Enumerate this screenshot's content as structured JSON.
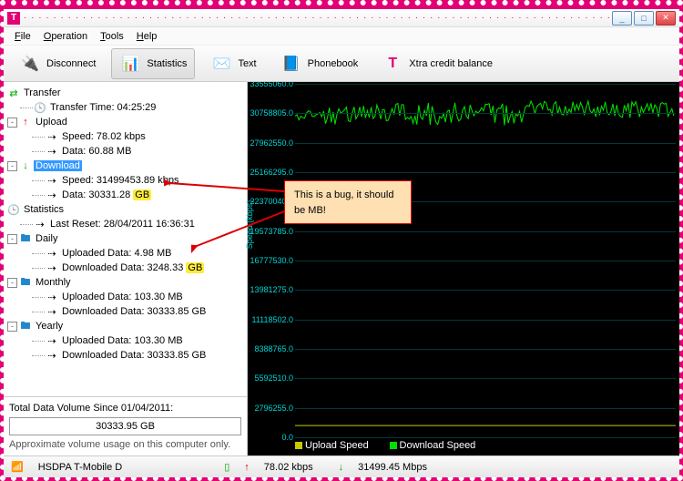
{
  "menu": {
    "file": "File",
    "operation": "Operation",
    "tools": "Tools",
    "help": "Help"
  },
  "toolbar": {
    "disconnect": "Disconnect",
    "statistics": "Statistics",
    "text": "Text",
    "phonebook": "Phonebook",
    "xtra": "Xtra credit balance"
  },
  "tree": {
    "transfer": "Transfer",
    "transfer_time": "Transfer Time: 04:25:29",
    "upload": "Upload",
    "upload_speed": "Speed: 78.02 kbps",
    "upload_data": "Data: 60.88 MB",
    "download": "Download",
    "download_speed": "Speed: 31499453.89 kbps",
    "download_data_pre": "Data: 30331.28 ",
    "download_data_unit": "GB",
    "statistics": "Statistics",
    "last_reset": "Last Reset: 28/04/2011 16:36:31",
    "daily": "Daily",
    "daily_up": "Uploaded Data: 4.98 MB",
    "daily_down_pre": "Downloaded Data: 3248.33 ",
    "daily_down_unit": "GB",
    "monthly": "Monthly",
    "monthly_up": "Uploaded Data: 103.30 MB",
    "monthly_down": "Downloaded Data: 30333.85 GB",
    "yearly": "Yearly",
    "yearly_up": "Uploaded Data: 103.30 MB",
    "yearly_down": "Downloaded Data: 30333.85 GB"
  },
  "total": {
    "label": "Total Data Volume Since 01/04/2011:",
    "value": "30333.95 GB",
    "note": "Approximate volume usage on this computer only."
  },
  "chart_data": {
    "type": "line",
    "ylabel": "Speed (kbps)",
    "ylim": [
      0,
      33555060
    ],
    "yticks": [
      0,
      2796255,
      5592510,
      8388765,
      11118502,
      13981275,
      16777530,
      19573785,
      22370040,
      25166295,
      27962550,
      30758805,
      33555060
    ],
    "series": [
      {
        "name": "Upload Speed",
        "color": "#c8c800",
        "approx": "near-zero flat line"
      },
      {
        "name": "Download Speed",
        "color": "#00e000",
        "approx": "fluctuating around 31,000,000"
      }
    ]
  },
  "legend": {
    "upload": "Upload Speed",
    "download": "Download Speed"
  },
  "status": {
    "net": "HSDPA T-Mobile D",
    "up": "78.02 kbps",
    "down": "31499.45 Mbps"
  },
  "annotation": "This is a bug, it should be MB!"
}
